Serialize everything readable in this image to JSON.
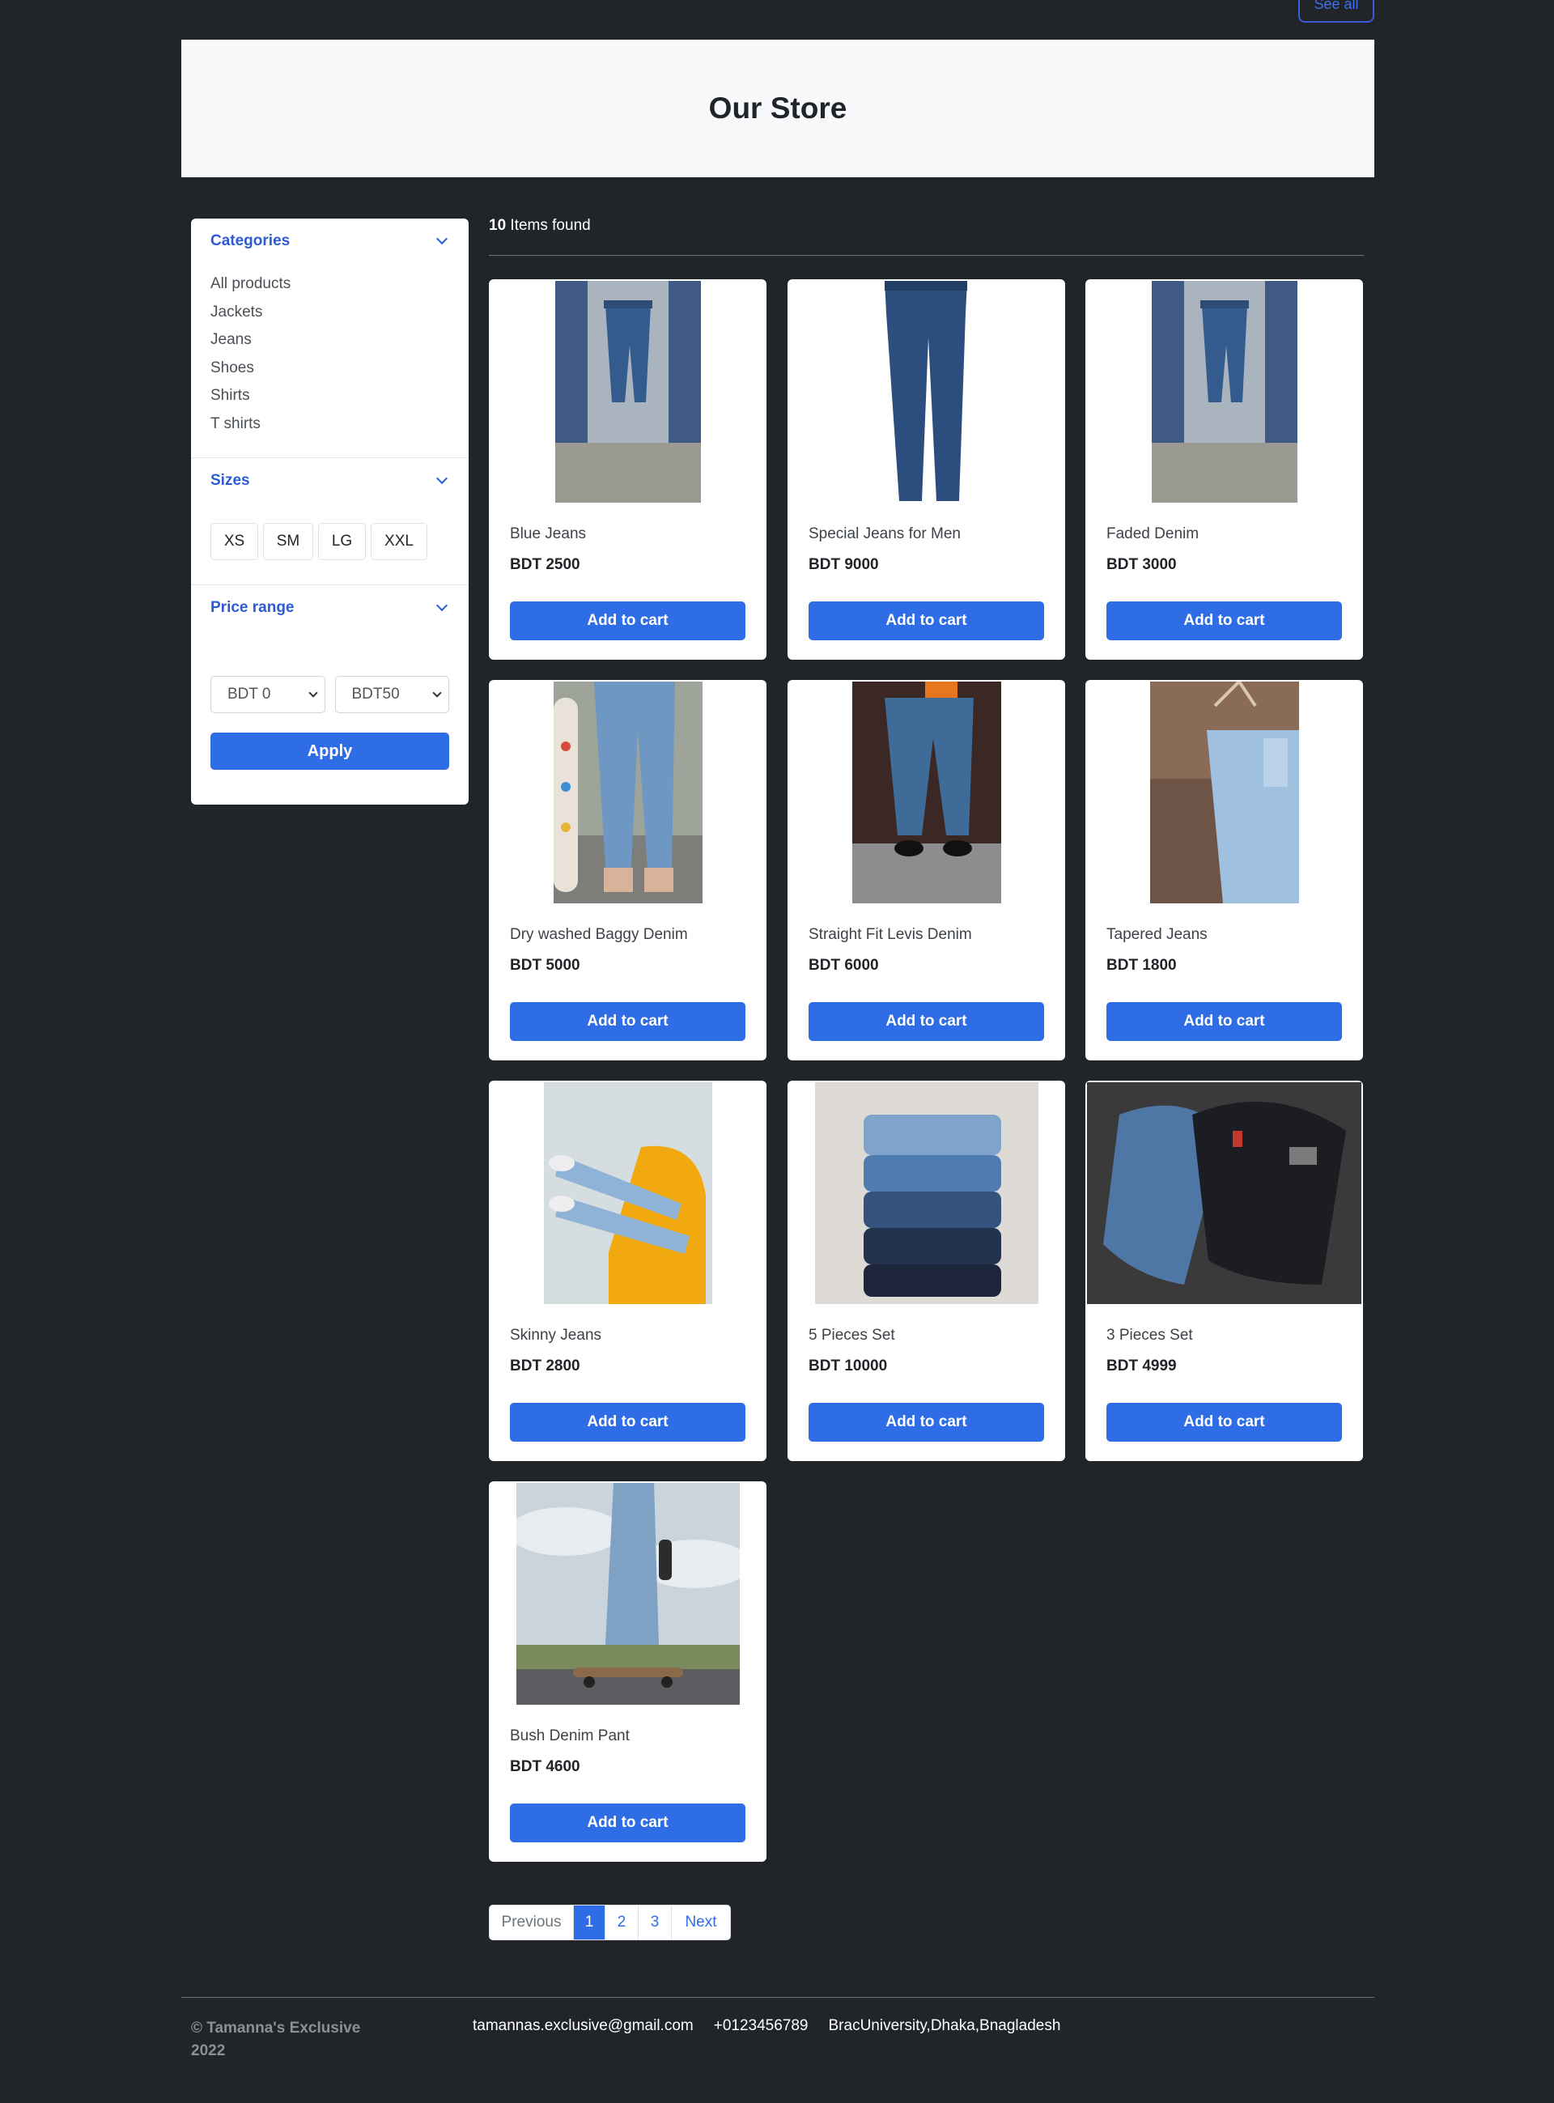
{
  "header": {
    "see_all": "See all",
    "title": "Our Store"
  },
  "sidebar": {
    "categories": {
      "title": "Categories",
      "items": [
        "All products",
        "Jackets",
        "Jeans",
        "Shoes",
        "Shirts",
        "T shirts"
      ]
    },
    "sizes": {
      "title": "Sizes",
      "items": [
        "XS",
        "SM",
        "LG",
        "XXL"
      ]
    },
    "price_range": {
      "title": "Price range",
      "min_value": "BDT 0",
      "max_value": "BDT50",
      "apply_label": "Apply"
    }
  },
  "results": {
    "count": "10",
    "label": " Items found"
  },
  "products": [
    {
      "name": "Blue Jeans",
      "price": "BDT 2500",
      "cart": "Add to cart"
    },
    {
      "name": "Special Jeans for Men",
      "price": "BDT 9000",
      "cart": "Add to cart"
    },
    {
      "name": "Faded Denim",
      "price": "BDT 3000",
      "cart": "Add to cart"
    },
    {
      "name": "Dry washed Baggy Denim",
      "price": "BDT 5000",
      "cart": "Add to cart"
    },
    {
      "name": "Straight Fit Levis Denim",
      "price": "BDT 6000",
      "cart": "Add to cart"
    },
    {
      "name": "Tapered Jeans",
      "price": "BDT 1800",
      "cart": "Add to cart"
    },
    {
      "name": "Skinny Jeans",
      "price": "BDT 2800",
      "cart": "Add to cart"
    },
    {
      "name": "5 Pieces Set",
      "price": "BDT 10000",
      "cart": "Add to cart"
    },
    {
      "name": "3 Pieces Set",
      "price": "BDT 4999",
      "cart": "Add to cart"
    },
    {
      "name": "Bush Denim Pant",
      "price": "BDT 4600",
      "cart": "Add to cart"
    }
  ],
  "pagination": {
    "previous": "Previous",
    "pages": [
      "1",
      "2",
      "3"
    ],
    "next": "Next",
    "current": "1"
  },
  "footer": {
    "copyright": "© Tamanna's Exclusive 2022",
    "email": "tamannas.exclusive@gmail.com",
    "phone": "+0123456789",
    "address": "BracUniversity,Dhaka,Bnagladesh"
  },
  "colors": {
    "accent": "#2f6de6",
    "background": "#212529",
    "panel": "#ffffff",
    "hero": "#f8f9fa"
  }
}
